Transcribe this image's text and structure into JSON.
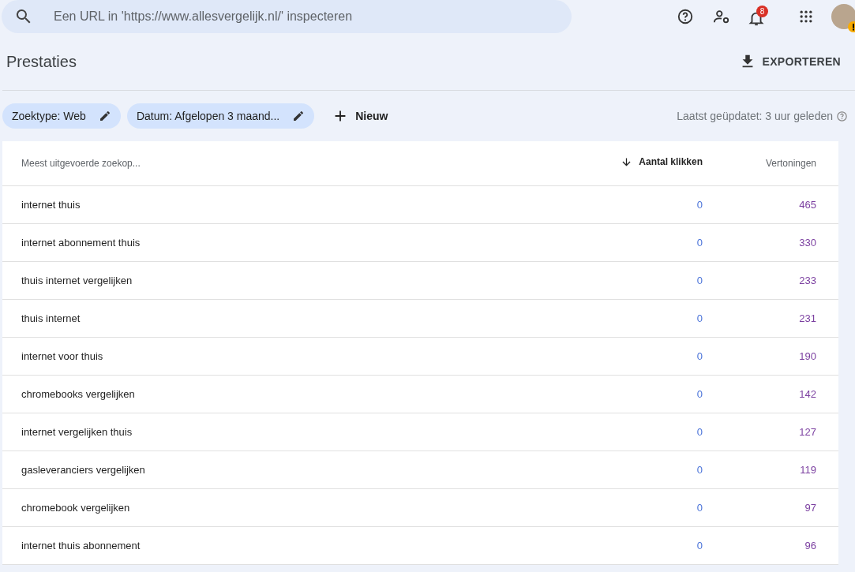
{
  "search": {
    "placeholder": "Een URL in 'https://www.allesvergelijk.nl/' inspecteren"
  },
  "header_icons": {
    "notification_count": "8"
  },
  "page": {
    "title": "Prestaties",
    "export_label": "EXPORTEREN"
  },
  "filters": [
    {
      "label": "Zoektype: Web"
    },
    {
      "label": "Datum: Afgelopen 3 maand..."
    }
  ],
  "new_filter_label": "Nieuw",
  "last_updated": "Laatst geüpdatet: 3 uur geleden",
  "table": {
    "columns": [
      {
        "label": "Meest uitgevoerde zoekop...",
        "sorted": false
      },
      {
        "label": "Aantal klikken",
        "sorted": true
      },
      {
        "label": "Vertoningen",
        "sorted": false
      }
    ],
    "rows": [
      [
        "internet thuis",
        "0",
        "465"
      ],
      [
        "internet abonnement thuis",
        "0",
        "330"
      ],
      [
        "thuis internet vergelijken",
        "0",
        "233"
      ],
      [
        "thuis internet",
        "0",
        "231"
      ],
      [
        "internet voor thuis",
        "0",
        "190"
      ],
      [
        "chromebooks vergelijken",
        "0",
        "142"
      ],
      [
        "internet vergelijken thuis",
        "0",
        "127"
      ],
      [
        "gasleveranciers vergelijken",
        "0",
        "119"
      ],
      [
        "chromebook vergelijken",
        "0",
        "97"
      ],
      [
        "internet thuis abonnement",
        "0",
        "96"
      ]
    ]
  }
}
